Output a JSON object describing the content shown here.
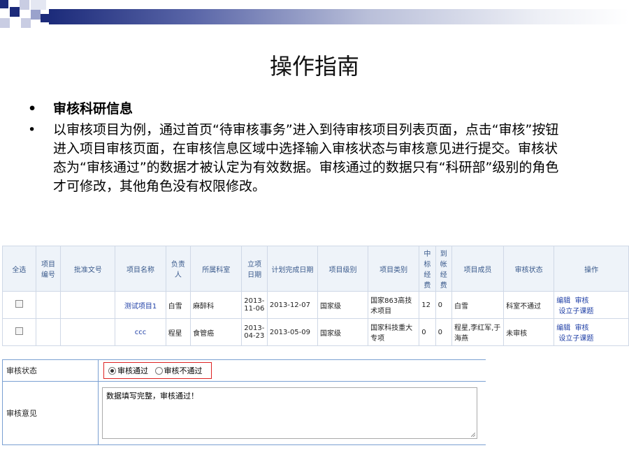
{
  "slide": {
    "title": "操作指南",
    "bullets": [
      {
        "text": "审核科研信息",
        "bold": true
      },
      {
        "text": "以审核项目为例，通过首页“待审核事务”进入到待审核项目列表页面，点击“审核”按钮进入项目审核页面，在审核信息区域中选择输入审核状态与审核意见进行提交。审核状态为“审核通过”的数据才被认定为有效数据。审核通过的数据只有“科研部”级别的角色才可修改，其他角色没有权限修改。",
        "bold": false
      }
    ],
    "bullet_glyph": "•"
  },
  "table": {
    "headers": [
      "全选",
      "项目编号",
      "批准文号",
      "项目名称",
      "负责人",
      "所属科室",
      "立项日期",
      "计划完成日期",
      "项目级别",
      "项目类别",
      "中标经费",
      "到帐经费",
      "项目成员",
      "审核状态",
      "操作"
    ],
    "rows": [
      {
        "number": "",
        "approval": "",
        "name": "测试项目1",
        "leader": "白雪",
        "dept": "麻醉科",
        "start_date": "2013-11-06",
        "plan_date": "2013-12-07",
        "level": "国家级",
        "category": "国家863高技术项目",
        "bid_fund": "12",
        "received_fund": "0",
        "members": "白雪",
        "status": "科室不通过",
        "actions": [
          "编辑",
          "审核",
          "设立子课题"
        ]
      },
      {
        "number": "",
        "approval": "",
        "name": "ccc",
        "leader": "程星",
        "dept": "食管癌",
        "start_date": "2013-04-23",
        "plan_date": "2013-05-09",
        "level": "国家级",
        "category": "国家科技重大专项",
        "bid_fund": "0",
        "received_fund": "0",
        "members": "程星,李红军,于海燕",
        "status": "未审核",
        "actions": [
          "编辑",
          "审核",
          "设立子课题"
        ]
      }
    ]
  },
  "review": {
    "status_label": "审核状态",
    "options": [
      {
        "label": "审核通过",
        "selected": true
      },
      {
        "label": "审核不通过",
        "selected": false
      }
    ],
    "opinion_label": "审核意见",
    "opinion_value": "数据填写完整，审核通过！"
  },
  "colors": {
    "header_text": "#3a5a8c",
    "link": "#1f3fa6",
    "highlight_border": "#dd2222",
    "deco_dark": "#1c2b7a"
  }
}
